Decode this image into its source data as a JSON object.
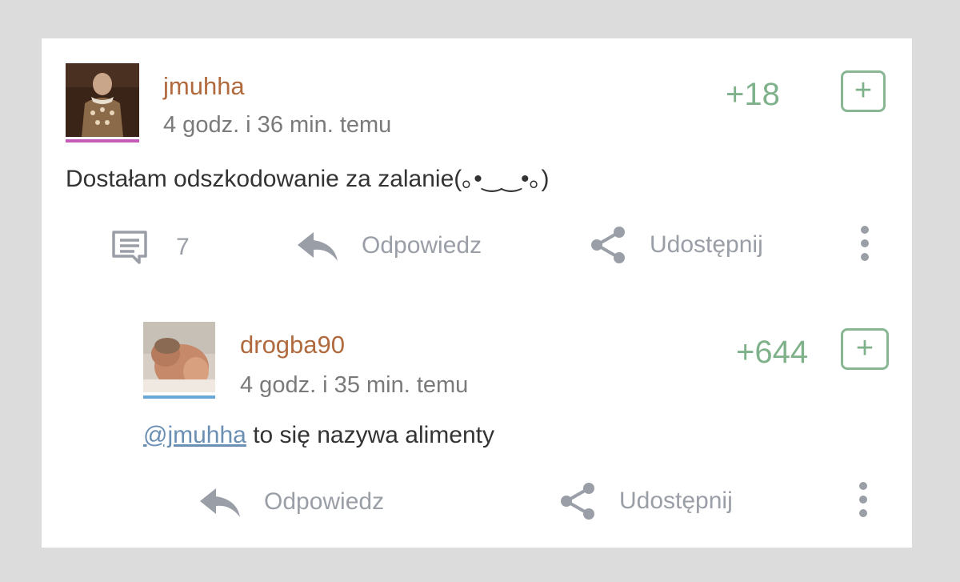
{
  "comments": [
    {
      "username": "jmuhha",
      "timestamp": "4 godz. i 36 min. temu",
      "score": "+18",
      "plus_label": "+",
      "text": "Dostałam odszkodowanie za zalanie(｡•‿‿•｡)",
      "reply_count": "7",
      "reply_label": "Odpowiedz",
      "share_label": "Udostępnij",
      "avatar_bar_color": "#c45bb8"
    },
    {
      "username": "drogba90",
      "timestamp": "4 godz. i 35 min. temu",
      "score": "+644",
      "plus_label": "+",
      "mention": "@jmuhha",
      "text": " to się nazywa alimenty",
      "reply_label": "Odpowiedz",
      "share_label": "Udostępnij",
      "avatar_bar_color": "#6aa8d8"
    }
  ],
  "colors": {
    "username": "#b06a3d",
    "score": "#7fb28b",
    "action": "#9a9ea6",
    "mention": "#6b8fb3"
  },
  "icons": [
    "comment-icon",
    "reply-arrow-icon",
    "share-icon",
    "more-vertical-icon",
    "plus-icon"
  ]
}
